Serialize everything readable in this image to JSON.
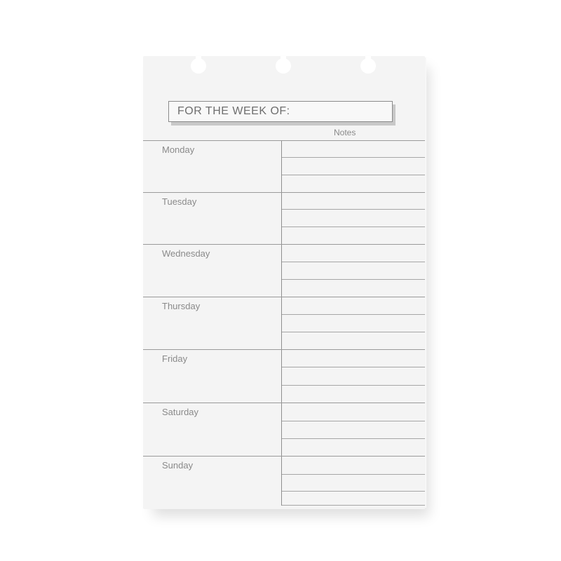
{
  "planner": {
    "header_label": "FOR THE WEEK OF:",
    "notes_label": "Notes",
    "days": [
      {
        "label": "Monday"
      },
      {
        "label": "Tuesday"
      },
      {
        "label": "Wednesday"
      },
      {
        "label": "Thursday"
      },
      {
        "label": "Friday"
      },
      {
        "label": "Saturday"
      },
      {
        "label": "Sunday"
      }
    ]
  },
  "colors": {
    "paper": "#f4f4f4",
    "ink": "#8a8a8a",
    "header_border": "#8a8a8a",
    "header_shadow": "#c8c8c8"
  }
}
